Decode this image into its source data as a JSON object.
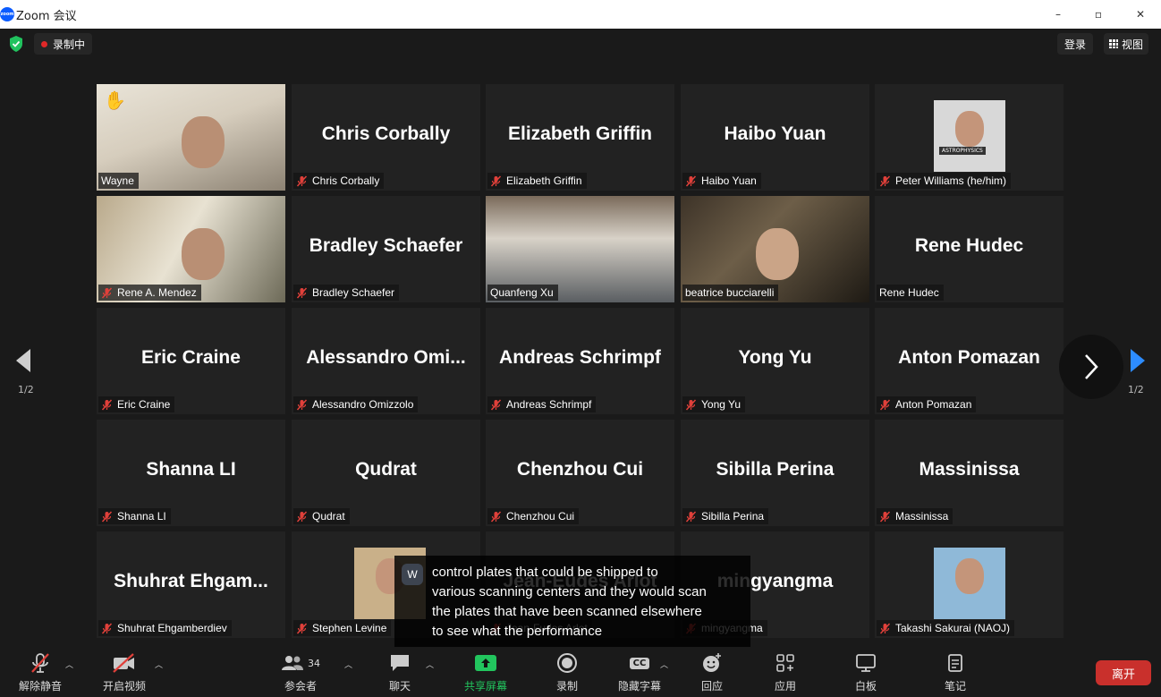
{
  "window": {
    "title": "Zoom 会议",
    "logo_text": "zoom",
    "minimize": "–",
    "maximize": "▫",
    "close": "✕"
  },
  "topbar": {
    "recording_label": "录制中",
    "signin_label": "登录",
    "view_label": "视图"
  },
  "gallery": {
    "page_left": "1/2",
    "page_right": "1/2",
    "tiles": [
      {
        "name": "Wayne",
        "big": "",
        "video": true
      },
      {
        "name": "Chris Corbally",
        "big": "Chris Corbally"
      },
      {
        "name": "Elizabeth Griffin",
        "big": "Elizabeth Griffin"
      },
      {
        "name": "Haibo Yuan",
        "big": "Haibo Yuan"
      },
      {
        "name": "Peter Williams (he/him)",
        "big": "",
        "avatar_text": "ASTROPHYSICS"
      },
      {
        "name": "Rene A. Mendez",
        "big": ""
      },
      {
        "name": "Bradley Schaefer",
        "big": "Bradley Schaefer"
      },
      {
        "name": "Quanfeng Xu",
        "big": ""
      },
      {
        "name": "beatrice bucciarelli",
        "big": ""
      },
      {
        "name": "Rene Hudec",
        "big": "Rene Hudec"
      },
      {
        "name": "Eric Craine",
        "big": "Eric Craine"
      },
      {
        "name": "Alessandro Omizzolo",
        "big": "Alessandro  Omi..."
      },
      {
        "name": "Andreas Schrimpf",
        "big": "Andreas Schrimpf"
      },
      {
        "name": "Yong Yu",
        "big": "Yong Yu"
      },
      {
        "name": "Anton Pomazan",
        "big": "Anton Pomazan"
      },
      {
        "name": "Shanna LI",
        "big": "Shanna LI"
      },
      {
        "name": "Qudrat",
        "big": "Qudrat"
      },
      {
        "name": "Chenzhou Cui",
        "big": "Chenzhou Cui"
      },
      {
        "name": "Sibilla Perina",
        "big": "Sibilla Perina"
      },
      {
        "name": "Massinissa",
        "big": "Massinissa"
      },
      {
        "name": "Shuhrat Ehgamberdiev",
        "big": "Shuhrat  Ehgam..."
      },
      {
        "name": "Stephen Levine",
        "big": ""
      },
      {
        "name": "Jean-Fudes Arlot",
        "big": "Jean-Eudes Arlot"
      },
      {
        "name": "mingyangma",
        "big": "mingyangma"
      },
      {
        "name": "Takashi Sakurai (NAOJ)",
        "big": ""
      }
    ]
  },
  "caption": {
    "speaker_initial": "W",
    "line1": "control plates that could be shipped to",
    "line2": "various scanning centers and they would scan",
    "line3": "the plates that have been scanned elsewhere",
    "line4": "to see what the performance"
  },
  "toolbar": {
    "unmute": "解除静音",
    "start_video": "开启视频",
    "participants": "参会者",
    "participants_count": "34",
    "chat": "聊天",
    "share": "共享屏幕",
    "record": "录制",
    "captions": "隐藏字幕",
    "cc": "CC",
    "reactions": "回应",
    "apps": "应用",
    "whiteboard": "白板",
    "notes": "笔记",
    "leave": "离开"
  },
  "colors": {
    "active_speaker": "#c8e85a",
    "share_green": "#22c55e",
    "leave_red": "#c9302c",
    "muted_red": "#e0403a",
    "nav_blue": "#2d8cff"
  }
}
